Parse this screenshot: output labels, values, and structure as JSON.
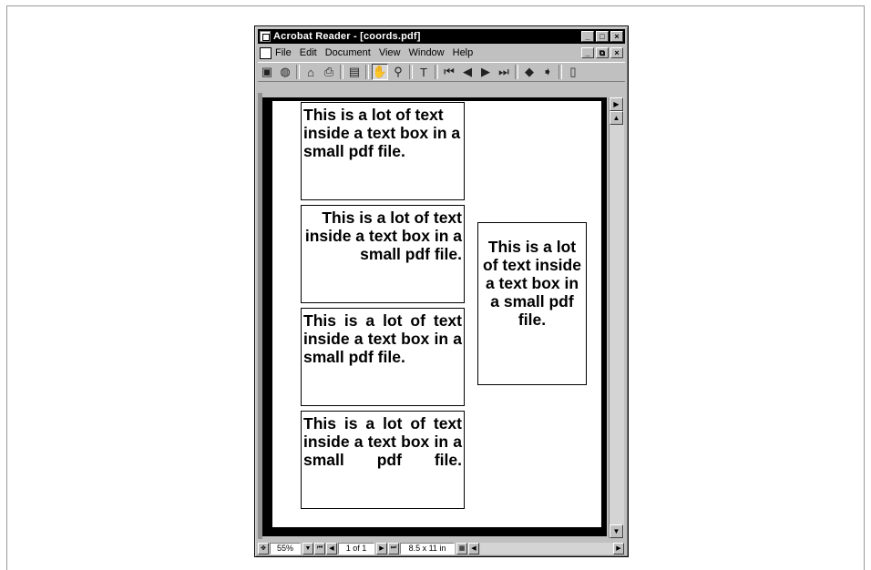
{
  "window": {
    "title": "Acrobat Reader - [coords.pdf]",
    "buttons": {
      "minimize": "_",
      "maximize": "□",
      "close": "×"
    }
  },
  "menu": {
    "items": [
      "File",
      "Edit",
      "Document",
      "View",
      "Window",
      "Help"
    ],
    "mdi_buttons": {
      "minimize": "_",
      "restore": "⧉",
      "close": "×"
    }
  },
  "toolbar": {
    "icons": [
      "thumbnails-icon",
      "web-icon",
      "open-icon",
      "print-icon",
      "page-icon",
      "hand-icon",
      "zoom-icon",
      "text-select-icon",
      "first-page-icon",
      "prev-page-icon",
      "next-page-icon",
      "last-page-icon",
      "back-icon",
      "forward-icon",
      "fit-icon"
    ]
  },
  "document": {
    "text_boxes": [
      {
        "text": "This is a lot of text inside a text box in a small pdf file.",
        "align": "left"
      },
      {
        "text": "This is a lot of text inside a text box in a small pdf file.",
        "align": "right"
      },
      {
        "text": "This is a lot of text inside a text box in a small pdf file.",
        "align": "justify"
      },
      {
        "text": "This is a lot of text inside a text box in a small pdf file.",
        "align": "justify-all"
      },
      {
        "text": "This is a lot of text inside a text box in a small pdf file.",
        "align": "center"
      }
    ]
  },
  "status": {
    "zoom": "55%",
    "page": "1 of 1",
    "page_size": "8.5 x 11 in"
  }
}
